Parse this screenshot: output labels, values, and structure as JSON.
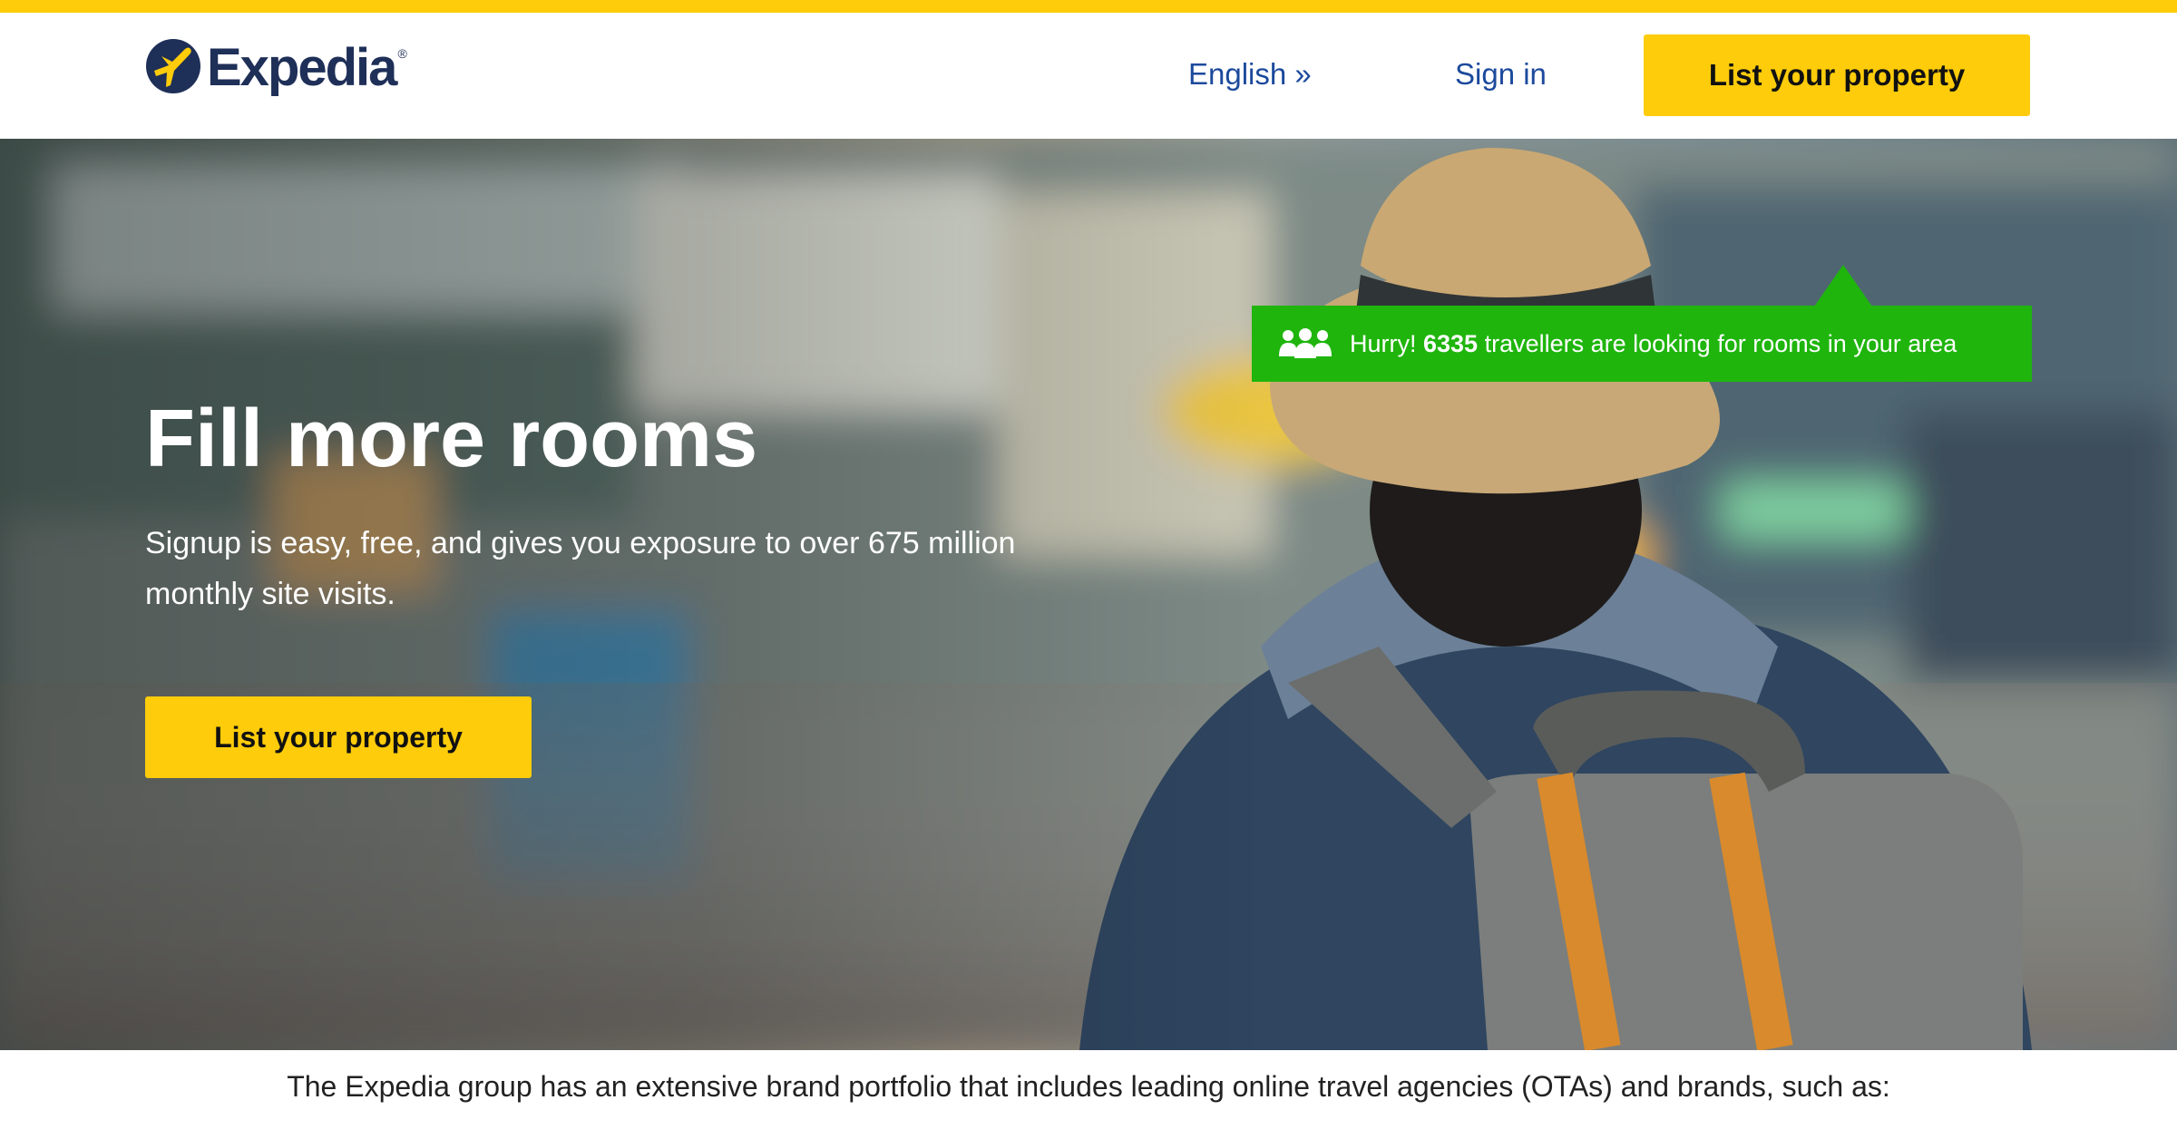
{
  "brand": {
    "name": "Expedia",
    "registered_mark": "®",
    "accent_color": "#fecc0a",
    "logo_color": "#1e2f58"
  },
  "header": {
    "language_link": "English »",
    "sign_in_link": "Sign in",
    "cta_label": "List your property"
  },
  "notice": {
    "icon": "users-group-icon",
    "prefix": "Hurry! ",
    "count": "6335",
    "suffix": " travellers are looking for rooms in your area",
    "color": "#1fb50d"
  },
  "hero": {
    "title": "Fill more rooms",
    "subtitle": "Signup is easy, free, and gives you exposure to over 675 million monthly site visits.",
    "cta_label": "List your property",
    "image": "traveller-with-backpack-on-street"
  },
  "footer": {
    "intro_text": "The Expedia group has an extensive brand portfolio that includes leading online travel agencies (OTAs) and brands, such as:"
  }
}
